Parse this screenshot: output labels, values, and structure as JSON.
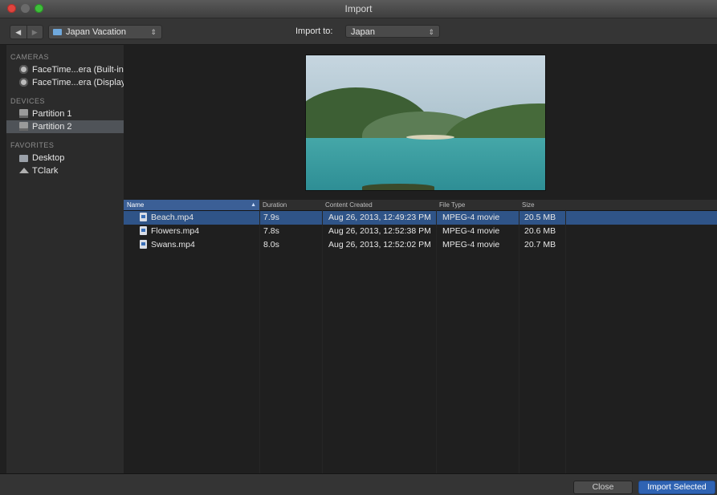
{
  "window": {
    "title": "Import"
  },
  "toolbar": {
    "back_glyph": "◀",
    "forward_glyph": "▶",
    "location": "Japan Vacation",
    "import_to_label": "Import to:",
    "import_to_value": "Japan"
  },
  "sidebar": {
    "cameras_header": "CAMERAS",
    "cameras": [
      {
        "label": "FaceTime...era (Built-in)",
        "icon": "camera-icon"
      },
      {
        "label": "FaceTime...era (Display)",
        "icon": "camera-icon"
      }
    ],
    "devices_header": "DEVICES",
    "devices": [
      {
        "label": "Partition 1",
        "icon": "drive-icon"
      },
      {
        "label": "Partition 2",
        "icon": "drive-icon",
        "selected": true
      }
    ],
    "favorites_header": "FAVORITES",
    "favorites": [
      {
        "label": "Desktop",
        "icon": "desktop-icon"
      },
      {
        "label": "TClark",
        "icon": "home-icon"
      }
    ]
  },
  "table": {
    "columns": {
      "name": "Name",
      "duration": "Duration",
      "created": "Content Created",
      "type": "File Type",
      "size": "Size"
    },
    "rows": [
      {
        "name": "Beach.mp4",
        "duration": "7.9s",
        "created": "Aug 26, 2013, 12:49:23 PM",
        "type": "MPEG-4 movie",
        "size": "20.5 MB"
      },
      {
        "name": "Flowers.mp4",
        "duration": "7.8s",
        "created": "Aug 26, 2013, 12:52:38 PM",
        "type": "MPEG-4 movie",
        "size": "20.6 MB"
      },
      {
        "name": "Swans.mp4",
        "duration": "8.0s",
        "created": "Aug 26, 2013, 12:52:02 PM",
        "type": "MPEG-4 movie",
        "size": "20.7 MB"
      }
    ]
  },
  "buttons": {
    "close": "Close",
    "import_selected": "Import Selected"
  },
  "colors": {
    "selection": "#2f5488",
    "primary_button": "#2f63b3",
    "sidebar_selected": "#4f5358"
  }
}
